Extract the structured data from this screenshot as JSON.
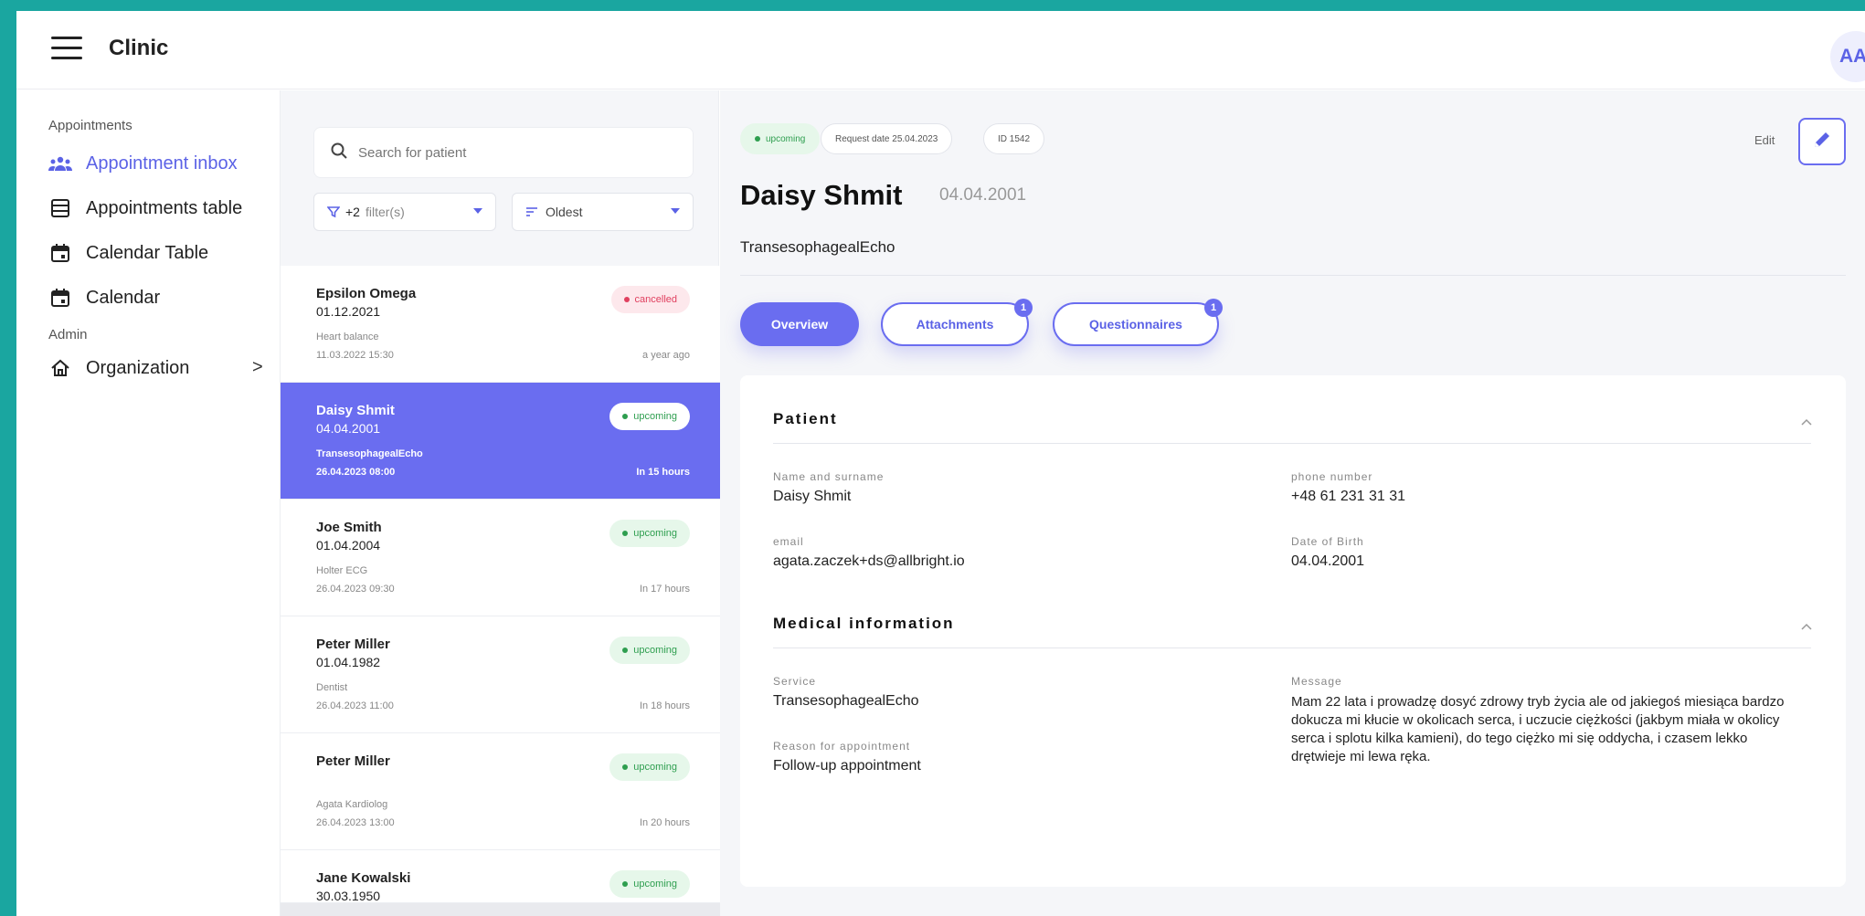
{
  "app": {
    "title": "Clinic",
    "avatar_initials": "AA"
  },
  "sidebar": {
    "sections": [
      {
        "label": "Appointments"
      },
      {
        "label": "Admin"
      }
    ],
    "items": [
      {
        "label": "Appointment inbox",
        "icon": "group-icon",
        "active": true
      },
      {
        "label": "Appointments table",
        "icon": "table-icon"
      },
      {
        "label": "Calendar Table",
        "icon": "calendar-icon"
      },
      {
        "label": "Calendar",
        "icon": "calendar-icon"
      },
      {
        "label": "Organization",
        "icon": "home-icon",
        "chevron": ">"
      }
    ]
  },
  "list": {
    "search_placeholder": "Search for patient",
    "filter_label": "+2",
    "filter_suffix": "filter(s)",
    "sort_label": "Oldest",
    "cards": [
      {
        "name": "Epsilon Omega",
        "dob": "01.12.2021",
        "service": "Heart balance",
        "datetime": "11.03.2022 15:30",
        "relative": "a year ago",
        "status": "cancelled"
      },
      {
        "name": "Daisy Shmit",
        "dob": "04.04.2001",
        "service": "TransesophagealEcho",
        "datetime": "26.04.2023 08:00",
        "relative": "In 15 hours",
        "status": "upcoming",
        "selected": true
      },
      {
        "name": "Joe Smith",
        "dob": "01.04.2004",
        "service": "Holter ECG",
        "datetime": "26.04.2023 09:30",
        "relative": "In 17 hours",
        "status": "upcoming"
      },
      {
        "name": "Peter Miller",
        "dob": "01.04.1982",
        "service": "Dentist",
        "datetime": "26.04.2023 11:00",
        "relative": "In 18 hours",
        "status": "upcoming"
      },
      {
        "name": "Peter Miller",
        "dob": "",
        "service": "Agata Kardiolog",
        "datetime": "26.04.2023 13:00",
        "relative": "In 20 hours",
        "status": "upcoming"
      },
      {
        "name": "Jane Kowalski",
        "dob": "30.03.1950",
        "service": "",
        "datetime": "",
        "relative": "",
        "status": "upcoming"
      }
    ]
  },
  "detail": {
    "status": "upcoming",
    "request_date": "Request date 25.04.2023",
    "id_label": "ID 1542",
    "edit_label": "Edit",
    "name": "Daisy Shmit",
    "dob": "04.04.2001",
    "service": "TransesophagealEcho",
    "tabs": [
      {
        "label": "Overview",
        "active": true
      },
      {
        "label": "Attachments",
        "count": "1"
      },
      {
        "label": "Questionnaires",
        "count": "1"
      }
    ],
    "patient": {
      "title": "Patient",
      "name_label": "Name and surname",
      "name_value": "Daisy Shmit",
      "phone_label": "phone number",
      "phone_value": "+48 61 231 31 31",
      "email_label": "email",
      "email_value": "agata.zaczek+ds@allbright.io",
      "dob_label": "Date of Birth",
      "dob_value": "04.04.2001"
    },
    "medical": {
      "title": "Medical information",
      "service_label": "Service",
      "service_value": "TransesophagealEcho",
      "reason_label": "Reason for appointment",
      "reason_value": "Follow-up appointment",
      "message_label": "Message",
      "message_value": "Mam 22 lata i prowadzę dosyć zdrowy tryb życia ale od jakiegoś miesiąca bardzo dokucza mi kłucie w okolicach serca, i uczucie ciężkości (jakbym miała w okolicy serca i splotu kilka kamieni), do tego ciężko mi się oddycha, i czasem lekko drętwieje mi lewa ręka."
    }
  },
  "colors": {
    "accent": "#6a6df0",
    "frame": "#1aa6a0",
    "upcoming": "#2e9e4f",
    "cancelled": "#e0405f"
  }
}
